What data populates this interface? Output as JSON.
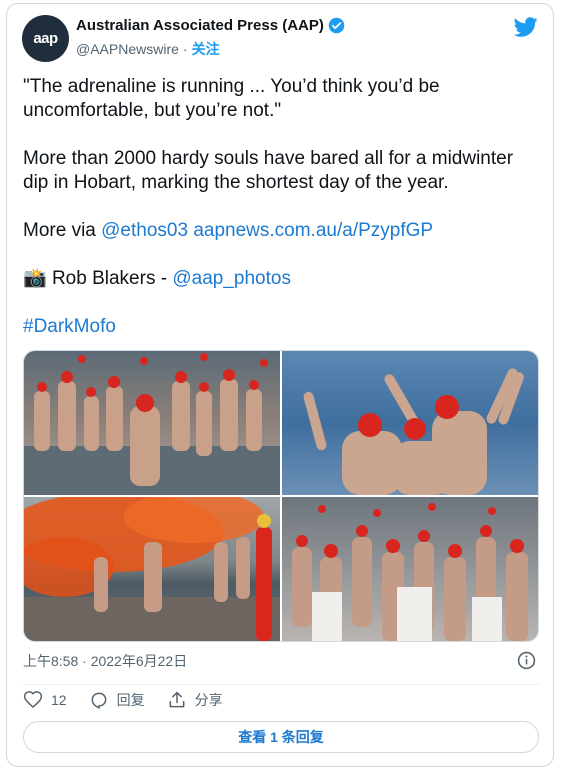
{
  "author": {
    "avatar_text": "aap",
    "name": "Australian Associated Press (AAP)",
    "handle": "@AAPNewswire",
    "separator": "·",
    "follow_label": "关注"
  },
  "tweet": {
    "quote": "\"The adrenaline is running ... You’d think you’d be uncomfortable, but you’re not.\"",
    "body": "More than 2000 hardy souls have bared all for a midwinter dip in Hobart, marking the shortest day of the year.",
    "more_via_label": "More via",
    "mention_1": "@ethos03",
    "link_url": "aapnews.com.au/a/PzypfGP",
    "camera_emoji": "📸",
    "credit_name": "Rob Blakers -",
    "mention_2": "@aap_photos",
    "hashtag": "#DarkMofo"
  },
  "meta": {
    "time": "上午8:58",
    "separator": "·",
    "date": "2022年6月22日"
  },
  "actions": {
    "like_count": "12",
    "reply_label": "回复",
    "share_label": "分享"
  },
  "reply_bar": {
    "label": "查看 1 条回复"
  },
  "colors": {
    "link": "#1d7ad1",
    "twitter_blue": "#1d9bf0",
    "border": "#cfd9de",
    "muted": "#536471"
  }
}
